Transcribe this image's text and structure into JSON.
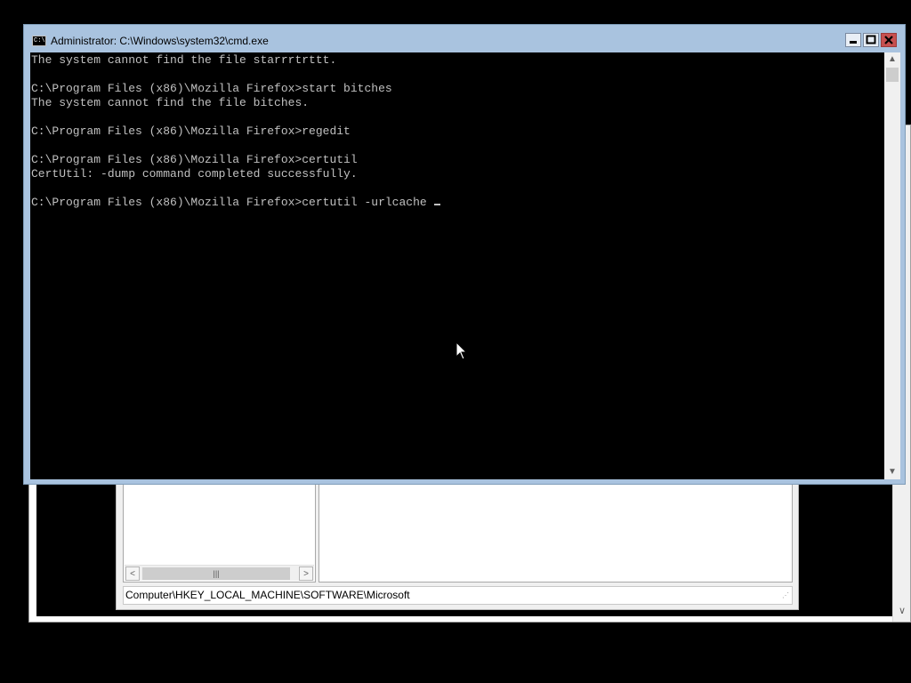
{
  "cmd_window": {
    "title": "Administrator: C:\\Windows\\system32\\cmd.exe",
    "icon_label": "C:\\",
    "buttons": {
      "minimize": "▬",
      "maximize": "▣",
      "close": "✕"
    },
    "console_lines": [
      "The system cannot find the file starrrtrttt.",
      "",
      "C:\\Program Files (x86)\\Mozilla Firefox>start bitches",
      "The system cannot find the file bitches.",
      "",
      "C:\\Program Files (x86)\\Mozilla Firefox>regedit",
      "",
      "C:\\Program Files (x86)\\Mozilla Firefox>certutil",
      "CertUtil: -dump command completed successfully.",
      "",
      "C:\\Program Files (x86)\\Mozilla Firefox>certutil -urlcache "
    ],
    "scroll_up": "▲",
    "scroll_down": "▼"
  },
  "regedit": {
    "status_path": "Computer\\HKEY_LOCAL_MACHINE\\SOFTWARE\\Microsoft",
    "scroll_left": "<",
    "scroll_right": ">",
    "thumb_grip": "|||"
  },
  "background_window": {
    "scroll_down": "∨"
  },
  "colors": {
    "console_bg": "#000000",
    "console_text": "#c0c0c0",
    "titlebar": "#a9c3df",
    "close_button": "#c75050"
  },
  "icons": [
    "cmd-icon",
    "minimize-icon",
    "maximize-icon",
    "close-icon",
    "mouse-pointer-icon"
  ]
}
